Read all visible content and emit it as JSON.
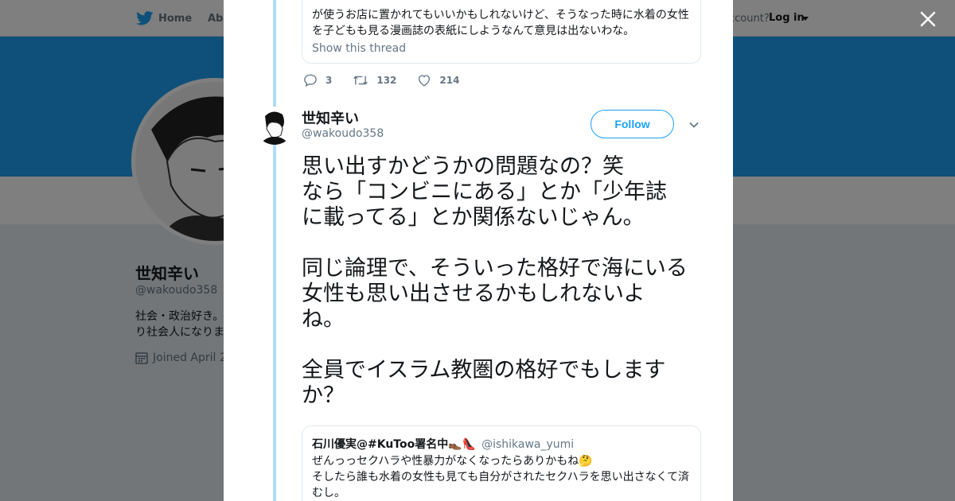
{
  "nav": {
    "home_label": "Home",
    "about_label_partial": "Abo",
    "account_label_partial": "ccount?",
    "login_label": "Log in"
  },
  "profile": {
    "name": "世知辛い",
    "handle": "@wakoudo358",
    "bio_partial": "社会・政治好き。\nり社会人になりま",
    "joined_partial": "Joined April 20"
  },
  "prev_tweet": {
    "quote_text": "が使うお店に置かれてもいいかもしれないけど、そうなった時に水着の女性\nを子どもも見る漫画誌の表紙にしようなんて意見は出ないわな。",
    "show_thread": "Show this thread",
    "replies": "3",
    "retweets": "132",
    "likes": "214"
  },
  "tweet": {
    "author_name": "世知辛い",
    "author_handle": "@wakoudo358",
    "follow_label": "Follow",
    "text": "思い出すかどうかの問題なの？笑\nなら「コンビニにある」とか「少年誌\nに載ってる」とか関係ないじゃん。\n\n同じ論理で、そういった格好で海にいる\n女性も思い出させるかもしれないよ\nね。\n\n全員でイスラム教圏の格好でもします\nか？"
  },
  "quoted": {
    "name": "石川優実@#KuToo署名中👞👠",
    "handle": "@ishikawa_yumi",
    "text": "ぜんっっセクハラや性暴力がなくなったらありかもね🤔\nそしたら誰も水着の女性も見ても自分がされたセクハラを思い出さなくて済\nむし。"
  },
  "colors": {
    "brand": "#1da1f2",
    "thread_line": "#b1dbf7",
    "text": "#14171a",
    "secondary": "#657786"
  },
  "icons": [
    "twitter-bird-icon",
    "close-icon",
    "reply-icon",
    "retweet-icon",
    "like-icon",
    "chevron-down-icon",
    "calendar-icon"
  ]
}
